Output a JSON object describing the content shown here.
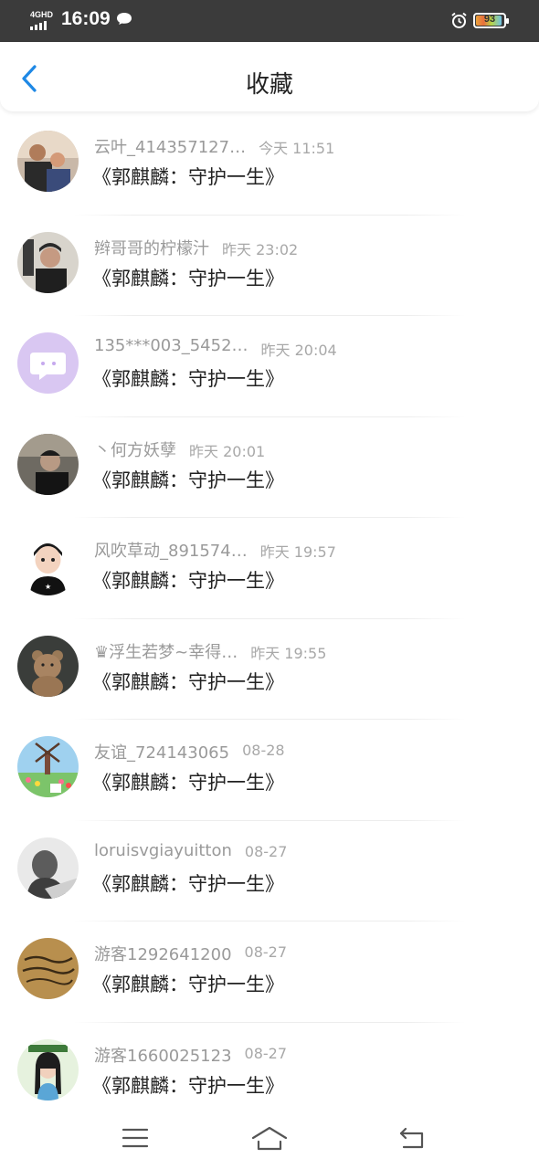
{
  "status_bar": {
    "network": "4GHD",
    "time": "16:09",
    "battery": "93",
    "battery_level": 0.93,
    "icons": [
      "signal-icon",
      "chat-bubble-icon",
      "alarm-icon",
      "battery-icon"
    ]
  },
  "header": {
    "back_icon": "chevron-left-icon",
    "title": "收藏"
  },
  "colors": {
    "accent": "#1e88e5",
    "status_bar_bg": "#3b3b3b",
    "secondary_text": "#9a9a9a"
  },
  "items": [
    {
      "username": "云叶_414357127…",
      "time": "今天 11:51",
      "title": "《郭麒麟：守护一生》"
    },
    {
      "username": "辫哥哥的柠檬汁",
      "time": "昨天 23:02",
      "title": "《郭麒麟：守护一生》"
    },
    {
      "username": "135***003_5452…",
      "time": "昨天 20:04",
      "title": "《郭麒麟：守护一生》"
    },
    {
      "username": "丶何方妖孽",
      "time": "昨天 20:01",
      "title": "《郭麒麟：守护一生》"
    },
    {
      "username": "风吹草动_891574…",
      "time": "昨天 19:57",
      "title": "《郭麒麟：守护一生》"
    },
    {
      "username": "♛浮生若梦~幸得…",
      "time": "昨天 19:55",
      "title": "《郭麒麟：守护一生》"
    },
    {
      "username": "友谊_724143065",
      "time": "08-28",
      "title": "《郭麒麟：守护一生》"
    },
    {
      "username": "loruisvgiayuitton",
      "time": "08-27",
      "title": "《郭麒麟：守护一生》"
    },
    {
      "username": "游客1292641200",
      "time": "08-27",
      "title": "《郭麒麟：守护一生》"
    },
    {
      "username": "游客1660025123",
      "time": "08-27",
      "title": "《郭麒麟：守护一生》"
    }
  ],
  "nav_bar": {
    "icons": [
      "menu-icon",
      "home-icon",
      "back-icon"
    ]
  }
}
